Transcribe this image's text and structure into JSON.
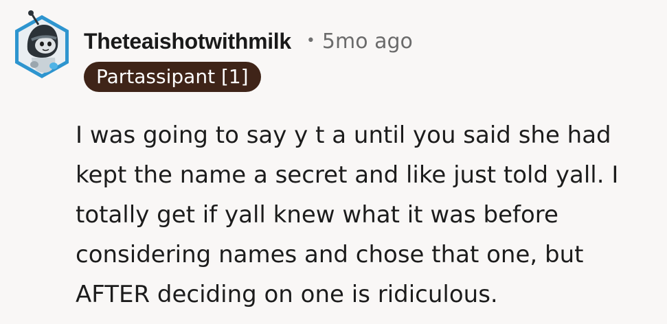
{
  "comment": {
    "author": "Theteaishotwithmilk",
    "separator": "•",
    "timestamp": "5mo ago",
    "flair": "Partassipant [1]",
    "avatar_icon": "snoo-avatar-icon",
    "body_lines": [
      "I was going to say y t a until you said she had",
      "kept the name a secret and like just told yall. I",
      "totally get if yall knew what it was before",
      "considering names and chose that one, but",
      "AFTER deciding on one is ridiculous."
    ]
  },
  "colors": {
    "background": "#f9f7f6",
    "flair_background": "#3f2418",
    "flair_text": "#ffffff",
    "author_text": "#1a1a1a",
    "meta_text": "#6b6b6b",
    "avatar_hex": "#2a8fc9"
  }
}
